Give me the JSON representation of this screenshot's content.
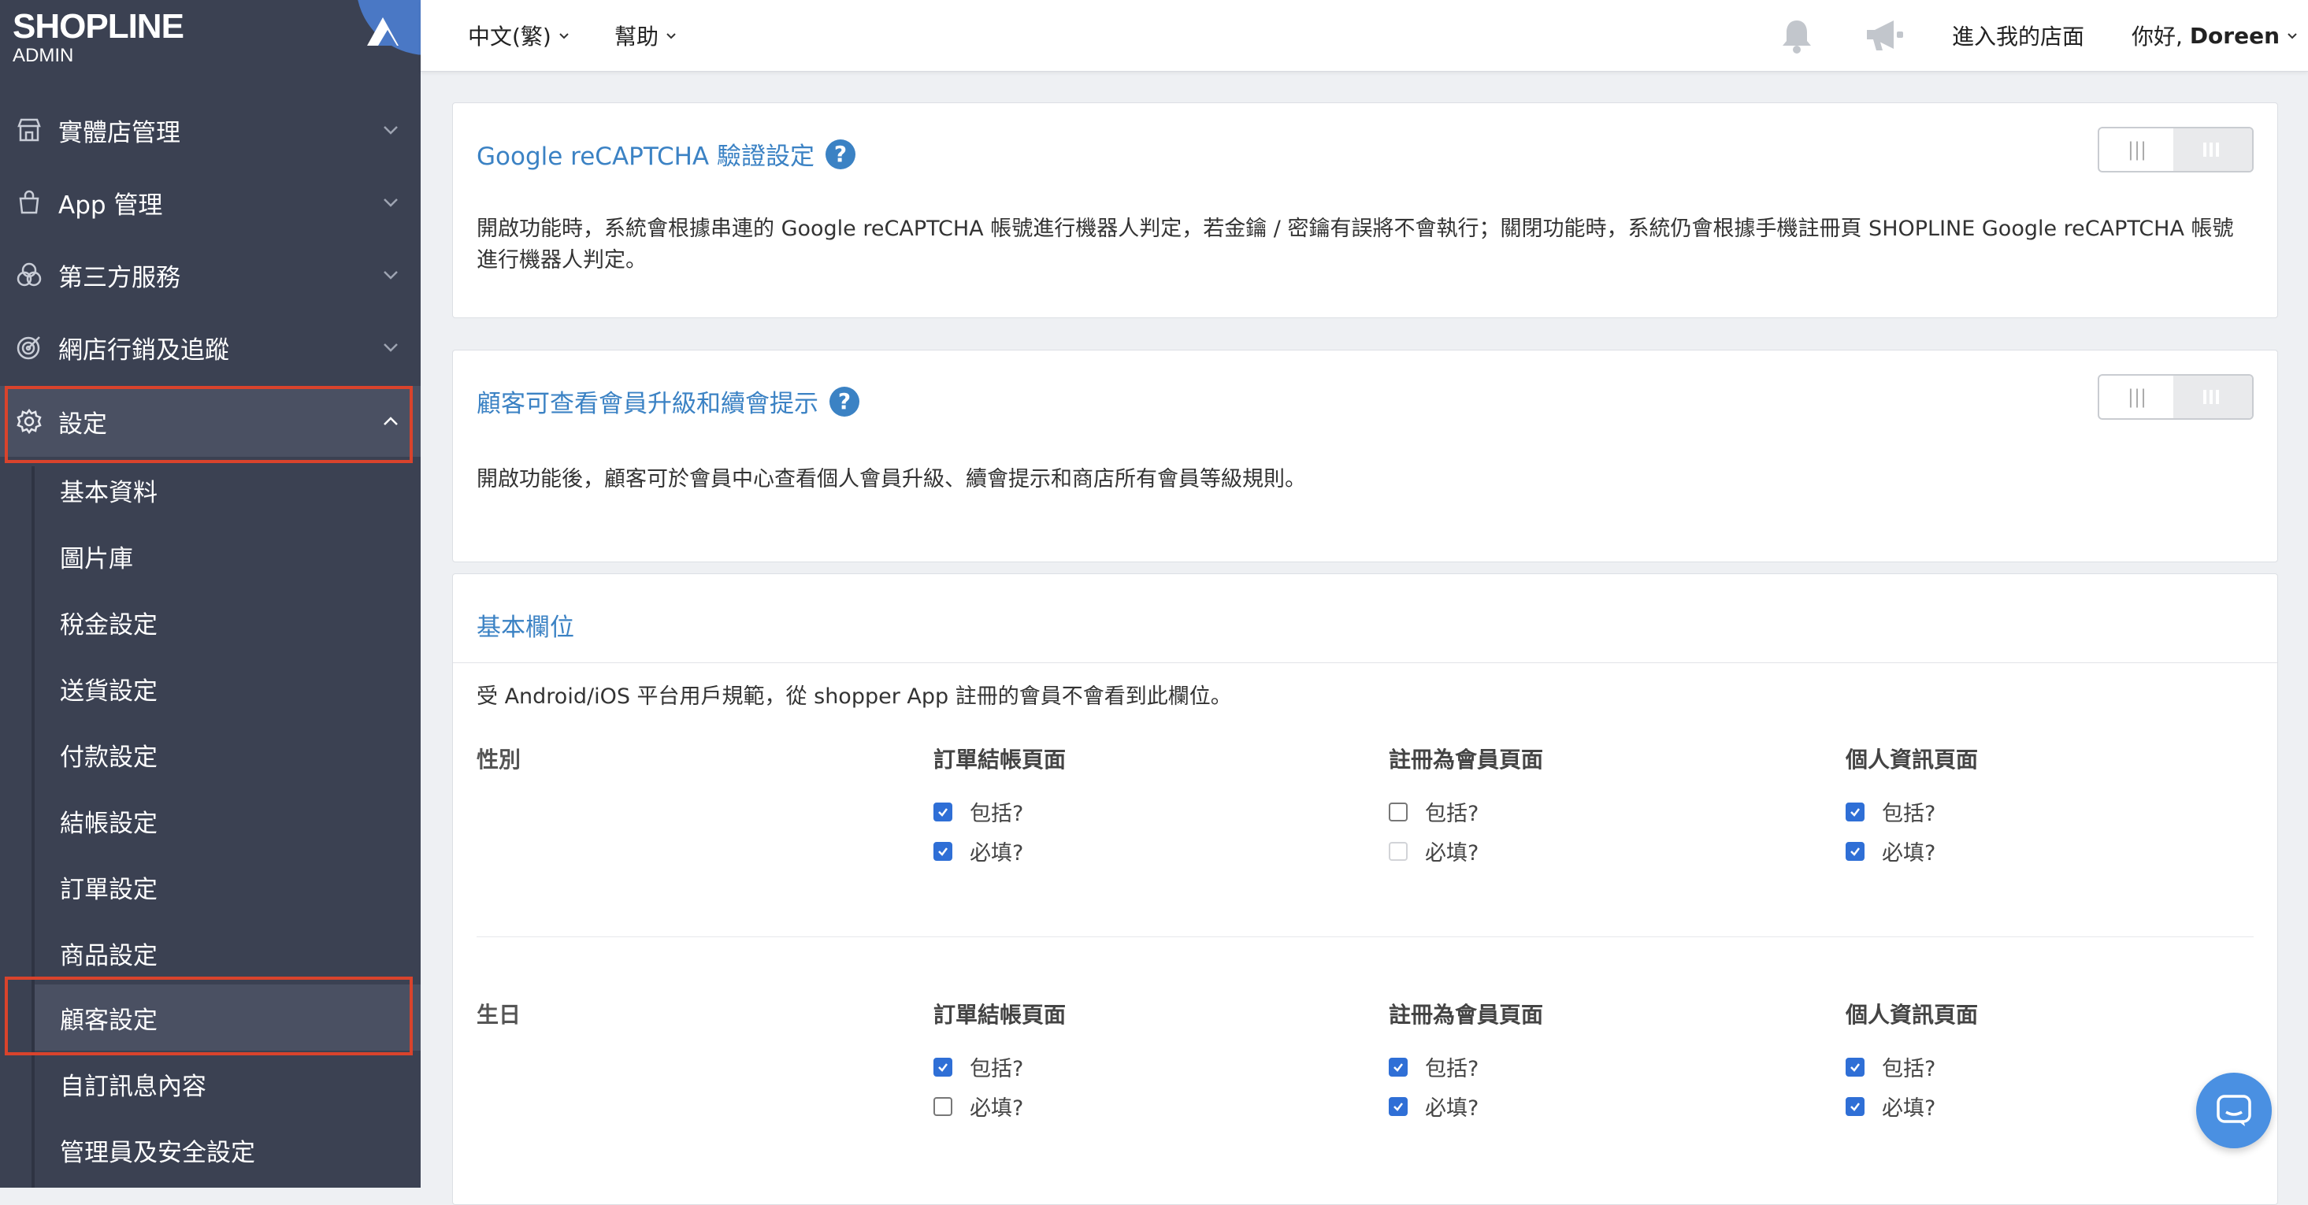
{
  "brand": {
    "logo": "SHOPLINE",
    "sub": "ADMIN"
  },
  "sidebar": {
    "items": [
      {
        "label": "實體店管理",
        "icon": "store-icon"
      },
      {
        "label": "App 管理",
        "icon": "shopping-bag-icon"
      },
      {
        "label": "第三方服務",
        "icon": "integrations-icon"
      },
      {
        "label": "網店行銷及追蹤",
        "icon": "target-icon"
      },
      {
        "label": "設定",
        "icon": "gear-icon",
        "expanded": true
      }
    ],
    "sub_items": [
      {
        "label": "基本資料"
      },
      {
        "label": "圖片庫"
      },
      {
        "label": "稅金設定"
      },
      {
        "label": "送貨設定"
      },
      {
        "label": "付款設定"
      },
      {
        "label": "結帳設定"
      },
      {
        "label": "訂單設定"
      },
      {
        "label": "商品設定"
      },
      {
        "label": "顧客設定",
        "active": true
      },
      {
        "label": "自訂訊息內容"
      },
      {
        "label": "管理員及安全設定"
      }
    ]
  },
  "topbar": {
    "language": "中文(繁)",
    "help": "幫助",
    "store_link": "進入我的店面",
    "greeting_prefix": "你好, ",
    "user_name": "Doreen"
  },
  "cards": {
    "recaptcha": {
      "title": "Google reCAPTCHA 驗證設定",
      "desc": "開啟功能時，系統會根據串連的 Google reCAPTCHA 帳號進行機器人判定，若金鑰 / 密鑰有誤將不會執行；關閉功能時，系統仍會根據手機註冊頁 SHOPLINE Google reCAPTCHA 帳號進行機器人判定。",
      "toggle_on": false
    },
    "membership": {
      "title": "顧客可查看會員升級和續會提示",
      "desc": "開啟功能後，顧客可於會員中心查看個人會員升級、續會提示和商店所有會員等級規則。",
      "toggle_on": false
    },
    "basic_fields": {
      "title": "基本欄位",
      "note": "受 Android/iOS 平台用戶規範，從 shopper App 註冊的會員不會看到此欄位。",
      "columns": [
        "訂單結帳頁面",
        "註冊為會員頁面",
        "個人資訊頁面"
      ],
      "include_label": "包括?",
      "required_label": "必填?",
      "fields": [
        {
          "label": "性別",
          "checks": [
            {
              "include": true,
              "required": true
            },
            {
              "include": false,
              "required": false,
              "required_disabled": true
            },
            {
              "include": true,
              "required": true
            }
          ]
        },
        {
          "label": "生日",
          "checks": [
            {
              "include": true,
              "required": false
            },
            {
              "include": true,
              "required": true
            },
            {
              "include": true,
              "required": true
            }
          ]
        }
      ]
    }
  },
  "colors": {
    "accent": "#3b82c4",
    "sidebar": "#3b4152",
    "highlight": "#d9432c",
    "checkbox": "#2f6fd6"
  }
}
